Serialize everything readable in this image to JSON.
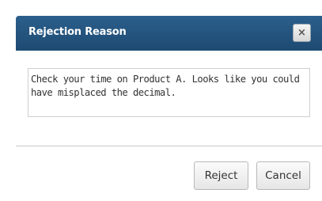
{
  "dialog": {
    "title": "Rejection Reason",
    "close_icon": "×",
    "reason_text": "Check your time on Product A. Looks like you could have misplaced the decimal.",
    "buttons": {
      "reject_label": "Reject",
      "cancel_label": "Cancel"
    }
  },
  "colors": {
    "titlebar": "#1f4d78",
    "title_text": "#ffffff"
  },
  "icons": {
    "close": "close-icon"
  }
}
